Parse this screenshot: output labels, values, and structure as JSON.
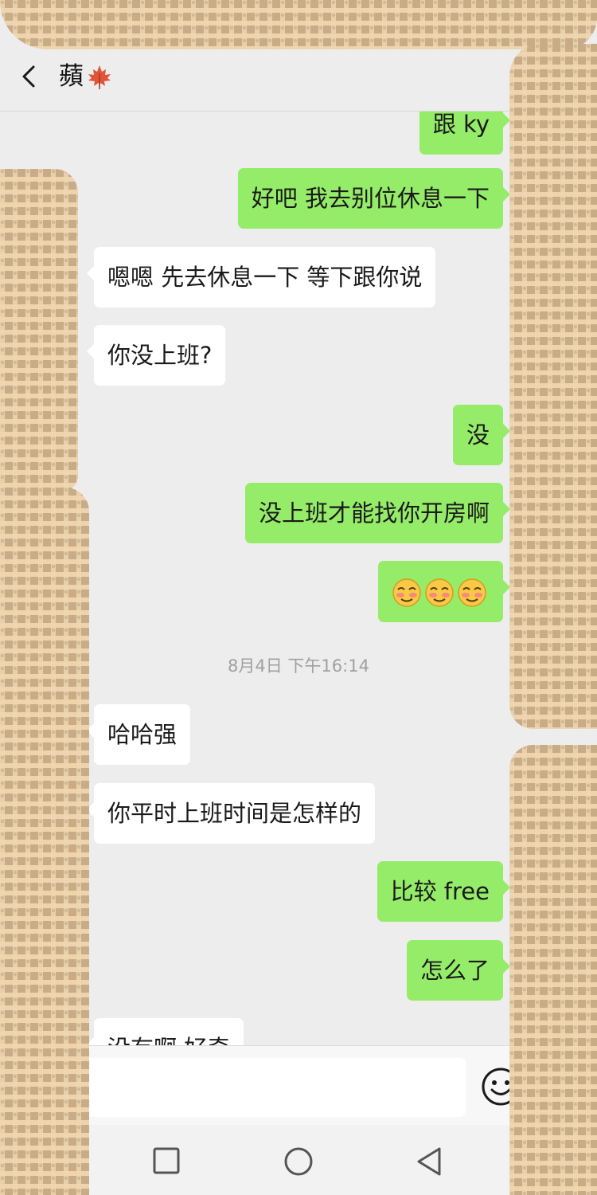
{
  "header": {
    "title": "蘋",
    "title_icon": "maple-leaf-icon",
    "back_icon": "chevron-left-icon"
  },
  "messages": [
    {
      "side": "right",
      "text": "跟 ky"
    },
    {
      "side": "right",
      "text": "好吧 我去别位休息一下"
    },
    {
      "side": "left",
      "text": "嗯嗯 先去休息一下 等下跟你说"
    },
    {
      "side": "left",
      "text": "你没上班?"
    },
    {
      "side": "right",
      "text": "没"
    },
    {
      "side": "right",
      "text": "没上班才能找你开房啊"
    },
    {
      "side": "right",
      "text": "",
      "emoji": "flushed-smile-icon",
      "emoji_count": 3
    },
    {
      "side": "left",
      "text": "哈哈强"
    },
    {
      "side": "left",
      "text": "你平时上班时间是怎样的"
    },
    {
      "side": "right",
      "text": "比较 free"
    },
    {
      "side": "right",
      "text": "怎么了"
    },
    {
      "side": "left",
      "text": "没有啊 好奇"
    }
  ],
  "timestamp": "8月4日 下午16:14",
  "input": {
    "value": "",
    "placeholder": "",
    "emoji_icon": "smiley-icon"
  },
  "navbar": {
    "icons": [
      "square-icon",
      "circle-icon",
      "triangle-back-icon"
    ]
  },
  "colors": {
    "background": "#ededed",
    "bubble_self": "#95ec69",
    "bubble_other": "#ffffff",
    "timestamp": "#a0a0a0"
  }
}
